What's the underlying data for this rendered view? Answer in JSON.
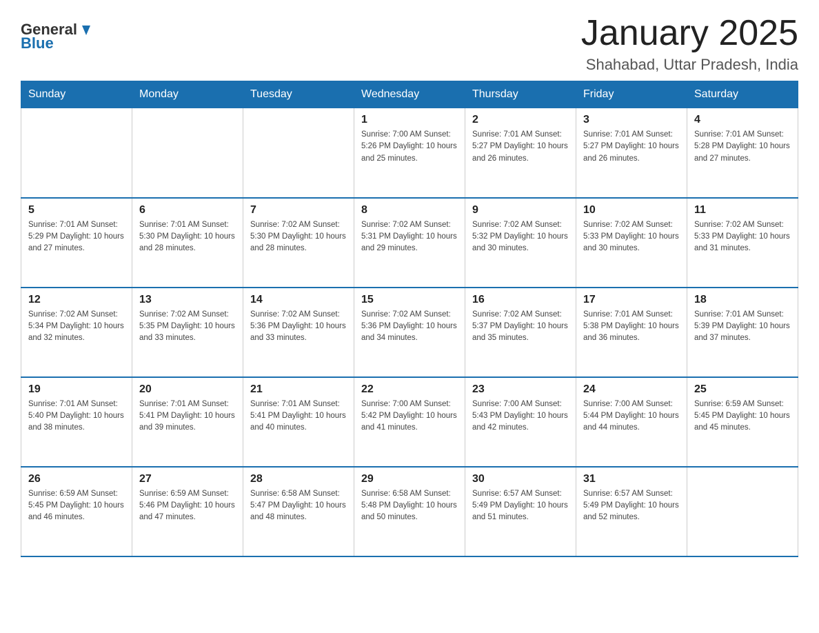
{
  "header": {
    "logo_general": "General",
    "logo_blue": "Blue",
    "title": "January 2025",
    "subtitle": "Shahabad, Uttar Pradesh, India"
  },
  "days_of_week": [
    "Sunday",
    "Monday",
    "Tuesday",
    "Wednesday",
    "Thursday",
    "Friday",
    "Saturday"
  ],
  "weeks": [
    [
      {
        "day": "",
        "info": ""
      },
      {
        "day": "",
        "info": ""
      },
      {
        "day": "",
        "info": ""
      },
      {
        "day": "1",
        "info": "Sunrise: 7:00 AM\nSunset: 5:26 PM\nDaylight: 10 hours\nand 25 minutes."
      },
      {
        "day": "2",
        "info": "Sunrise: 7:01 AM\nSunset: 5:27 PM\nDaylight: 10 hours\nand 26 minutes."
      },
      {
        "day": "3",
        "info": "Sunrise: 7:01 AM\nSunset: 5:27 PM\nDaylight: 10 hours\nand 26 minutes."
      },
      {
        "day": "4",
        "info": "Sunrise: 7:01 AM\nSunset: 5:28 PM\nDaylight: 10 hours\nand 27 minutes."
      }
    ],
    [
      {
        "day": "5",
        "info": "Sunrise: 7:01 AM\nSunset: 5:29 PM\nDaylight: 10 hours\nand 27 minutes."
      },
      {
        "day": "6",
        "info": "Sunrise: 7:01 AM\nSunset: 5:30 PM\nDaylight: 10 hours\nand 28 minutes."
      },
      {
        "day": "7",
        "info": "Sunrise: 7:02 AM\nSunset: 5:30 PM\nDaylight: 10 hours\nand 28 minutes."
      },
      {
        "day": "8",
        "info": "Sunrise: 7:02 AM\nSunset: 5:31 PM\nDaylight: 10 hours\nand 29 minutes."
      },
      {
        "day": "9",
        "info": "Sunrise: 7:02 AM\nSunset: 5:32 PM\nDaylight: 10 hours\nand 30 minutes."
      },
      {
        "day": "10",
        "info": "Sunrise: 7:02 AM\nSunset: 5:33 PM\nDaylight: 10 hours\nand 30 minutes."
      },
      {
        "day": "11",
        "info": "Sunrise: 7:02 AM\nSunset: 5:33 PM\nDaylight: 10 hours\nand 31 minutes."
      }
    ],
    [
      {
        "day": "12",
        "info": "Sunrise: 7:02 AM\nSunset: 5:34 PM\nDaylight: 10 hours\nand 32 minutes."
      },
      {
        "day": "13",
        "info": "Sunrise: 7:02 AM\nSunset: 5:35 PM\nDaylight: 10 hours\nand 33 minutes."
      },
      {
        "day": "14",
        "info": "Sunrise: 7:02 AM\nSunset: 5:36 PM\nDaylight: 10 hours\nand 33 minutes."
      },
      {
        "day": "15",
        "info": "Sunrise: 7:02 AM\nSunset: 5:36 PM\nDaylight: 10 hours\nand 34 minutes."
      },
      {
        "day": "16",
        "info": "Sunrise: 7:02 AM\nSunset: 5:37 PM\nDaylight: 10 hours\nand 35 minutes."
      },
      {
        "day": "17",
        "info": "Sunrise: 7:01 AM\nSunset: 5:38 PM\nDaylight: 10 hours\nand 36 minutes."
      },
      {
        "day": "18",
        "info": "Sunrise: 7:01 AM\nSunset: 5:39 PM\nDaylight: 10 hours\nand 37 minutes."
      }
    ],
    [
      {
        "day": "19",
        "info": "Sunrise: 7:01 AM\nSunset: 5:40 PM\nDaylight: 10 hours\nand 38 minutes."
      },
      {
        "day": "20",
        "info": "Sunrise: 7:01 AM\nSunset: 5:41 PM\nDaylight: 10 hours\nand 39 minutes."
      },
      {
        "day": "21",
        "info": "Sunrise: 7:01 AM\nSunset: 5:41 PM\nDaylight: 10 hours\nand 40 minutes."
      },
      {
        "day": "22",
        "info": "Sunrise: 7:00 AM\nSunset: 5:42 PM\nDaylight: 10 hours\nand 41 minutes."
      },
      {
        "day": "23",
        "info": "Sunrise: 7:00 AM\nSunset: 5:43 PM\nDaylight: 10 hours\nand 42 minutes."
      },
      {
        "day": "24",
        "info": "Sunrise: 7:00 AM\nSunset: 5:44 PM\nDaylight: 10 hours\nand 44 minutes."
      },
      {
        "day": "25",
        "info": "Sunrise: 6:59 AM\nSunset: 5:45 PM\nDaylight: 10 hours\nand 45 minutes."
      }
    ],
    [
      {
        "day": "26",
        "info": "Sunrise: 6:59 AM\nSunset: 5:45 PM\nDaylight: 10 hours\nand 46 minutes."
      },
      {
        "day": "27",
        "info": "Sunrise: 6:59 AM\nSunset: 5:46 PM\nDaylight: 10 hours\nand 47 minutes."
      },
      {
        "day": "28",
        "info": "Sunrise: 6:58 AM\nSunset: 5:47 PM\nDaylight: 10 hours\nand 48 minutes."
      },
      {
        "day": "29",
        "info": "Sunrise: 6:58 AM\nSunset: 5:48 PM\nDaylight: 10 hours\nand 50 minutes."
      },
      {
        "day": "30",
        "info": "Sunrise: 6:57 AM\nSunset: 5:49 PM\nDaylight: 10 hours\nand 51 minutes."
      },
      {
        "day": "31",
        "info": "Sunrise: 6:57 AM\nSunset: 5:49 PM\nDaylight: 10 hours\nand 52 minutes."
      },
      {
        "day": "",
        "info": ""
      }
    ]
  ]
}
